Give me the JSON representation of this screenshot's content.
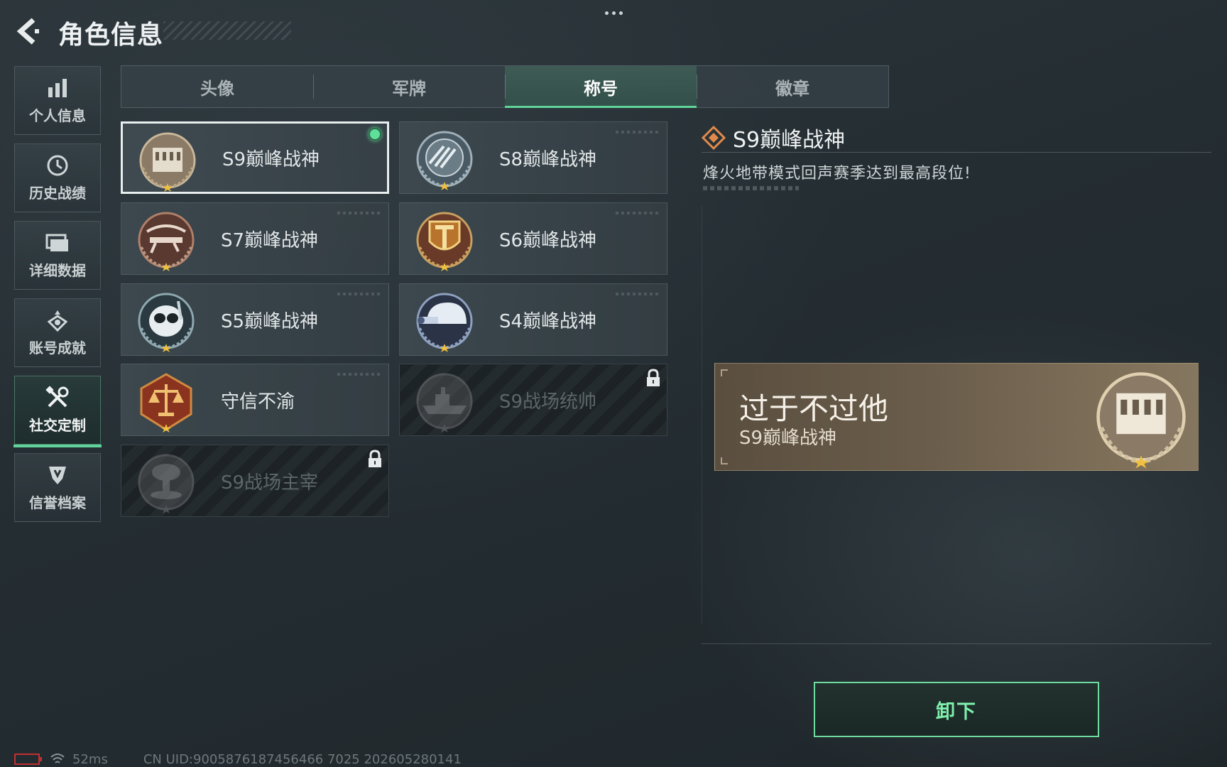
{
  "header": {
    "title": "角色信息",
    "back_icon": "back-arrow-icon",
    "more_icon": "more-dots-icon"
  },
  "sidebar": {
    "items": [
      {
        "label": "个人信息",
        "icon": "bar-chart-icon",
        "active": false
      },
      {
        "label": "历史战绩",
        "icon": "clock-icon",
        "active": false
      },
      {
        "label": "详细数据",
        "icon": "folder-icon",
        "active": false
      },
      {
        "label": "账号成就",
        "icon": "achievement-icon",
        "active": false
      },
      {
        "label": "社交定制",
        "icon": "tools-icon",
        "active": true
      },
      {
        "label": "信誉档案",
        "icon": "shield-icon",
        "active": false
      }
    ],
    "accent": "#5fd39a"
  },
  "tabs": [
    {
      "label": "头像",
      "active": false
    },
    {
      "label": "军牌",
      "active": false
    },
    {
      "label": "称号",
      "active": true
    },
    {
      "label": "徽章",
      "active": false
    }
  ],
  "titles": [
    {
      "name": "S9巅峰战神",
      "medal": "building-medal-icon",
      "state": "equipped"
    },
    {
      "name": "S8巅峰战神",
      "medal": "emblem-medal-icon",
      "state": "unlocked"
    },
    {
      "name": "S7巅峰战神",
      "medal": "crossbow-medal-icon",
      "state": "unlocked"
    },
    {
      "name": "S6巅峰战神",
      "medal": "shield-t-medal-icon",
      "state": "unlocked"
    },
    {
      "name": "S5巅峰战神",
      "medal": "diving-mask-medal-icon",
      "state": "unlocked"
    },
    {
      "name": "S4巅峰战神",
      "medal": "night-vision-helmet-medal-icon",
      "state": "unlocked"
    },
    {
      "name": "守信不渝",
      "medal": "scales-medal-icon",
      "state": "unlocked"
    },
    {
      "name": "S9战场统帅",
      "medal": "warship-medal-icon",
      "state": "locked"
    },
    {
      "name": "S9战场主宰",
      "medal": "mushroom-cloud-medal-icon",
      "state": "locked"
    }
  ],
  "detail": {
    "title": "S9巅峰战神",
    "description": "烽火地带模式回声赛季达到最高段位!",
    "title_icon": "diamond-icon"
  },
  "preview": {
    "player_name": "过于不过他",
    "title": "S9巅峰战神",
    "medal": "building-medal-icon"
  },
  "actions": {
    "unequip_label": "卸下",
    "accent": "#6fdc9f"
  },
  "footer": {
    "ping": "52ms",
    "uid": "CN UID:9005876187456466 7025 202605280141"
  }
}
